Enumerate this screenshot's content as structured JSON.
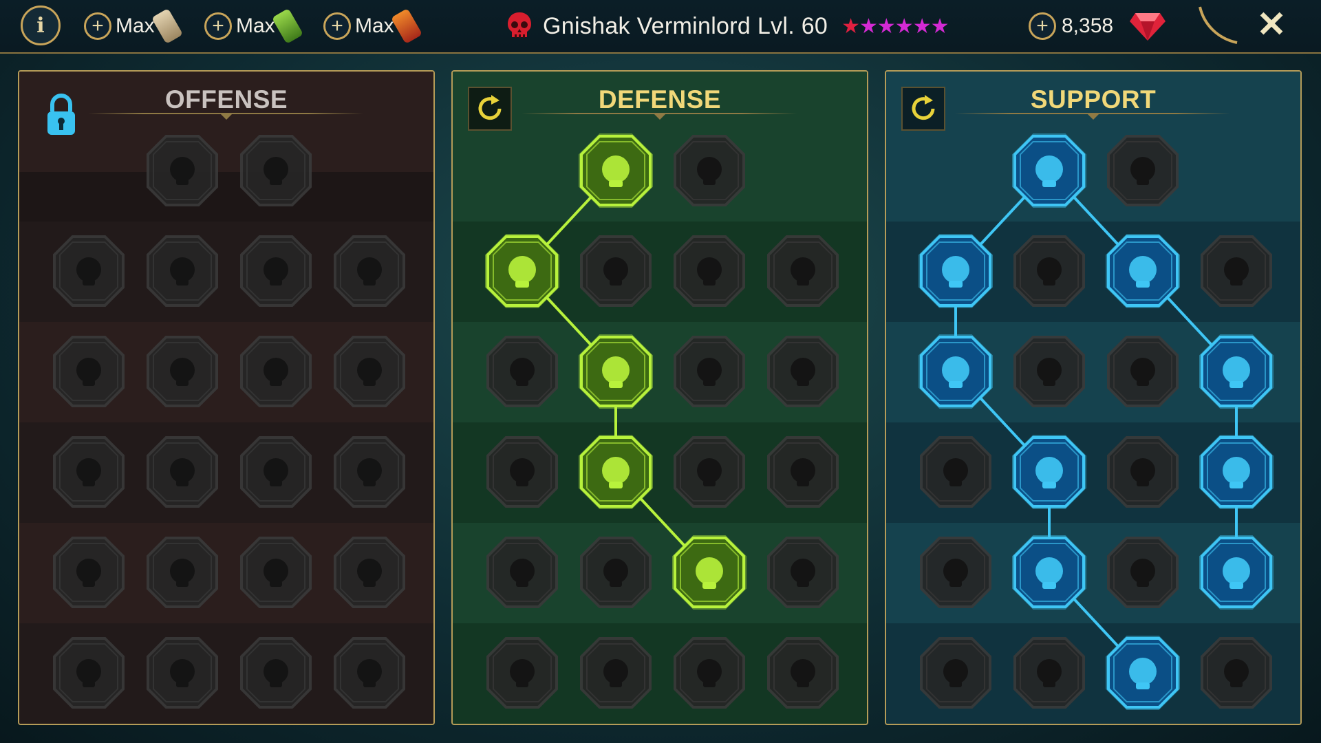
{
  "topbar": {
    "info_label": "i",
    "resources": [
      {
        "label": "Max",
        "color": "#cbb38a"
      },
      {
        "label": "Max",
        "color": "#7fbf3a"
      },
      {
        "label": "Max",
        "color": "#d0512a"
      }
    ],
    "champion_name": "Gnishak Verminlord Lvl. 60",
    "stars": {
      "red": "★",
      "pink": "★★★★★"
    },
    "gems_value": "8,358",
    "close_label": "✕"
  },
  "panels": {
    "offense": {
      "title": "OFFENSE",
      "locked": true
    },
    "defense": {
      "title": "DEFENSE"
    },
    "support": {
      "title": "SUPPORT"
    }
  },
  "colors": {
    "defense_active": "#b8f23c",
    "support_active": "#3fc6f5",
    "inactive": "#1b1b1b"
  },
  "offense_nodes": [
    [
      "",
      "swords-icon",
      "daggers-icon",
      ""
    ],
    [
      "demon-heart-icon",
      "sword-slash-icon",
      "shield-break-icon",
      "cursed-heart-icon"
    ],
    [
      "arrow-hit-icon",
      "fangs-icon",
      "skull-cloak-icon",
      "blade-hand-icon"
    ],
    [
      "bleeding-heart-icon",
      "fist-sword-icon",
      "axe-icon",
      "chain-lightning-icon"
    ],
    [
      "spider-icon",
      "twin-skull-icon",
      "dagger-ring-icon",
      "berserker-icon"
    ],
    [
      "sparkle-sword-icon",
      "knight-helm-icon",
      "dark-lord-icon",
      "spiked-skull-icon"
    ]
  ],
  "defense_nodes": [
    [
      "",
      "armor-plates-icon",
      "fist-icon",
      ""
    ],
    [
      "chevron-shield-icon",
      "heart-hand-icon",
      "armored-body-icon",
      "crossed-blades-icon"
    ],
    [
      "dancer-icon",
      "knight-shield-icon",
      "heart-icon",
      "hooded-figure-icon"
    ],
    [
      "crowd-icon",
      "hourglass-skull-icon",
      "palm-icon",
      "bull-icon"
    ],
    [
      "running-man-icon",
      "droplets-icon",
      "radiant-skull-icon",
      "swipe-icon"
    ],
    [
      "beast-icon",
      "winged-shield-icon",
      "bearded-face-icon",
      "muscle-icon"
    ]
  ],
  "support_nodes": [
    [
      "",
      "heart-plus-icon",
      "spiral-icon",
      ""
    ],
    [
      "praying-hands-icon",
      "dome-shield-icon",
      "flame-skull-icon",
      "fast-hand-icon"
    ],
    [
      "healer-icon",
      "lightning-icon",
      "crack-icon",
      "shadow-clone-icon"
    ],
    [
      "heart-chain-icon",
      "comet-icon",
      "book-icon",
      "angry-eyes-icon"
    ],
    [
      "compass-icon",
      "speed-boot-icon",
      "eye-icon",
      "voodoo-icon"
    ],
    [
      "potion-icon",
      "horned-skull-icon",
      "shackled-fist-icon",
      "eagle-icon"
    ]
  ],
  "defense_active": [
    [
      0,
      1
    ],
    [
      1,
      0
    ],
    [
      2,
      1
    ],
    [
      3,
      1
    ],
    [
      4,
      2
    ]
  ],
  "support_active": [
    [
      0,
      1
    ],
    [
      1,
      0
    ],
    [
      1,
      2
    ],
    [
      2,
      0
    ],
    [
      2,
      3
    ],
    [
      3,
      1
    ],
    [
      3,
      3
    ],
    [
      4,
      1
    ],
    [
      4,
      3
    ],
    [
      5,
      2
    ]
  ],
  "defense_links": [
    [
      [
        0,
        1
      ],
      [
        1,
        0
      ]
    ],
    [
      [
        1,
        0
      ],
      [
        2,
        1
      ]
    ],
    [
      [
        2,
        1
      ],
      [
        3,
        1
      ]
    ],
    [
      [
        3,
        1
      ],
      [
        4,
        2
      ]
    ]
  ],
  "support_links": [
    [
      [
        0,
        1
      ],
      [
        1,
        0
      ]
    ],
    [
      [
        0,
        1
      ],
      [
        1,
        2
      ]
    ],
    [
      [
        1,
        0
      ],
      [
        2,
        0
      ]
    ],
    [
      [
        1,
        2
      ],
      [
        2,
        3
      ]
    ],
    [
      [
        2,
        0
      ],
      [
        3,
        1
      ]
    ],
    [
      [
        2,
        3
      ],
      [
        3,
        3
      ]
    ],
    [
      [
        3,
        1
      ],
      [
        4,
        1
      ]
    ],
    [
      [
        3,
        3
      ],
      [
        4,
        3
      ]
    ],
    [
      [
        4,
        1
      ],
      [
        5,
        2
      ]
    ]
  ]
}
